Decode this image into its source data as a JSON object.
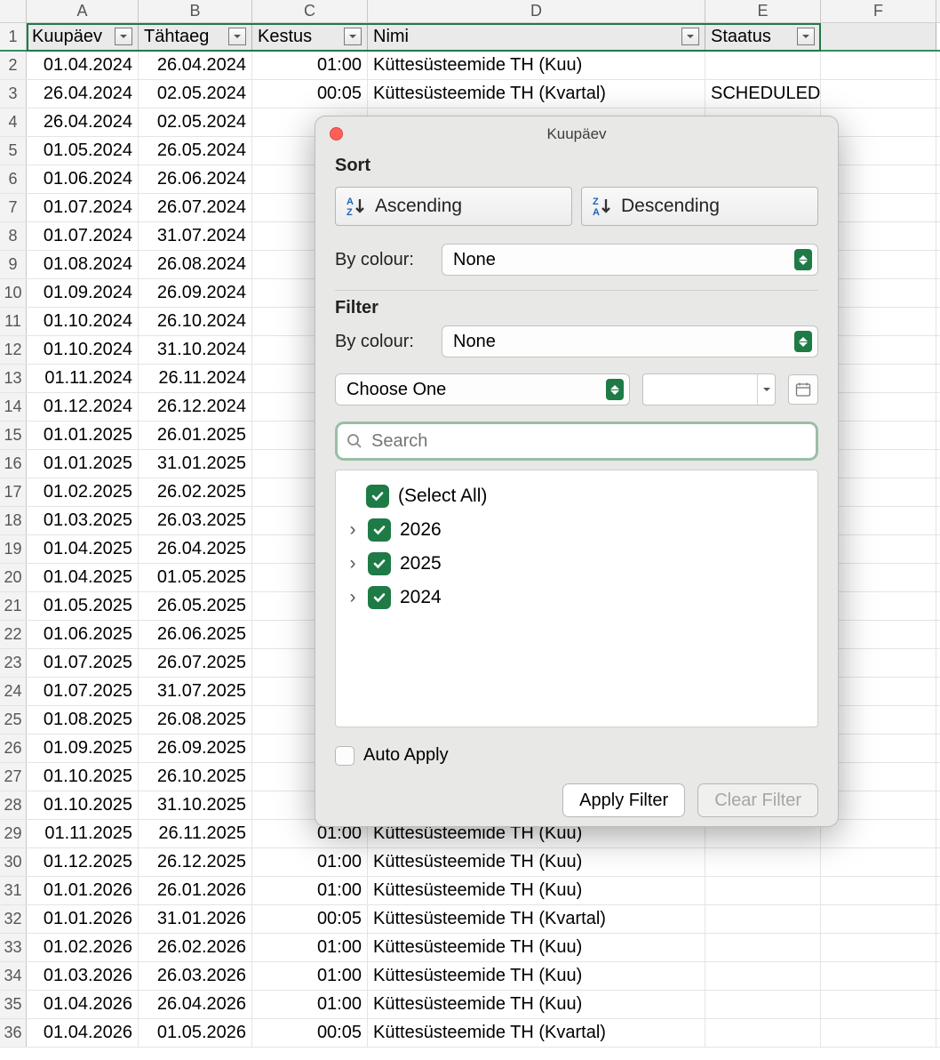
{
  "columns": [
    "A",
    "B",
    "C",
    "D",
    "E",
    "F"
  ],
  "headers": {
    "A": "Kuupäev",
    "B": "Tähtaeg",
    "C": "Kestus",
    "D": "Nimi",
    "E": "Staatus"
  },
  "rows": [
    {
      "n": 2,
      "A": "01.04.2024",
      "B": "26.04.2024",
      "C": "01:00",
      "D": "Küttesüsteemide TH (Kuu)",
      "E": ""
    },
    {
      "n": 3,
      "A": "26.04.2024",
      "B": "02.05.2024",
      "C": "00:05",
      "D": "Küttesüsteemide TH (Kvartal)",
      "E": "SCHEDULED"
    },
    {
      "n": 4,
      "A": "26.04.2024",
      "B": "02.05.2024",
      "C": "",
      "D": "",
      "E": ""
    },
    {
      "n": 5,
      "A": "01.05.2024",
      "B": "26.05.2024",
      "C": "",
      "D": "",
      "E": ""
    },
    {
      "n": 6,
      "A": "01.06.2024",
      "B": "26.06.2024",
      "C": "",
      "D": "",
      "E": ""
    },
    {
      "n": 7,
      "A": "01.07.2024",
      "B": "26.07.2024",
      "C": "",
      "D": "",
      "E": ""
    },
    {
      "n": 8,
      "A": "01.07.2024",
      "B": "31.07.2024",
      "C": "",
      "D": "",
      "E": ""
    },
    {
      "n": 9,
      "A": "01.08.2024",
      "B": "26.08.2024",
      "C": "",
      "D": "",
      "E": ""
    },
    {
      "n": 10,
      "A": "01.09.2024",
      "B": "26.09.2024",
      "C": "",
      "D": "",
      "E": ""
    },
    {
      "n": 11,
      "A": "01.10.2024",
      "B": "26.10.2024",
      "C": "",
      "D": "",
      "E": ""
    },
    {
      "n": 12,
      "A": "01.10.2024",
      "B": "31.10.2024",
      "C": "",
      "D": "",
      "E": ""
    },
    {
      "n": 13,
      "A": "01.11.2024",
      "B": "26.11.2024",
      "C": "",
      "D": "",
      "E": ""
    },
    {
      "n": 14,
      "A": "01.12.2024",
      "B": "26.12.2024",
      "C": "",
      "D": "",
      "E": ""
    },
    {
      "n": 15,
      "A": "01.01.2025",
      "B": "26.01.2025",
      "C": "",
      "D": "",
      "E": ""
    },
    {
      "n": 16,
      "A": "01.01.2025",
      "B": "31.01.2025",
      "C": "",
      "D": "",
      "E": ""
    },
    {
      "n": 17,
      "A": "01.02.2025",
      "B": "26.02.2025",
      "C": "",
      "D": "",
      "E": ""
    },
    {
      "n": 18,
      "A": "01.03.2025",
      "B": "26.03.2025",
      "C": "",
      "D": "",
      "E": ""
    },
    {
      "n": 19,
      "A": "01.04.2025",
      "B": "26.04.2025",
      "C": "",
      "D": "",
      "E": ""
    },
    {
      "n": 20,
      "A": "01.04.2025",
      "B": "01.05.2025",
      "C": "",
      "D": "",
      "E": ""
    },
    {
      "n": 21,
      "A": "01.05.2025",
      "B": "26.05.2025",
      "C": "",
      "D": "",
      "E": ""
    },
    {
      "n": 22,
      "A": "01.06.2025",
      "B": "26.06.2025",
      "C": "",
      "D": "",
      "E": ""
    },
    {
      "n": 23,
      "A": "01.07.2025",
      "B": "26.07.2025",
      "C": "",
      "D": "",
      "E": ""
    },
    {
      "n": 24,
      "A": "01.07.2025",
      "B": "31.07.2025",
      "C": "",
      "D": "",
      "E": ""
    },
    {
      "n": 25,
      "A": "01.08.2025",
      "B": "26.08.2025",
      "C": "",
      "D": "",
      "E": ""
    },
    {
      "n": 26,
      "A": "01.09.2025",
      "B": "26.09.2025",
      "C": "",
      "D": "",
      "E": ""
    },
    {
      "n": 27,
      "A": "01.10.2025",
      "B": "26.10.2025",
      "C": "",
      "D": "",
      "E": ""
    },
    {
      "n": 28,
      "A": "01.10.2025",
      "B": "31.10.2025",
      "C": "",
      "D": "",
      "E": ""
    },
    {
      "n": 29,
      "A": "01.11.2025",
      "B": "26.11.2025",
      "C": "01:00",
      "D": "Küttesüsteemide TH (Kuu)",
      "E": ""
    },
    {
      "n": 30,
      "A": "01.12.2025",
      "B": "26.12.2025",
      "C": "01:00",
      "D": "Küttesüsteemide TH (Kuu)",
      "E": ""
    },
    {
      "n": 31,
      "A": "01.01.2026",
      "B": "26.01.2026",
      "C": "01:00",
      "D": "Küttesüsteemide TH (Kuu)",
      "E": ""
    },
    {
      "n": 32,
      "A": "01.01.2026",
      "B": "31.01.2026",
      "C": "00:05",
      "D": "Küttesüsteemide TH (Kvartal)",
      "E": ""
    },
    {
      "n": 33,
      "A": "01.02.2026",
      "B": "26.02.2026",
      "C": "01:00",
      "D": "Küttesüsteemide TH (Kuu)",
      "E": ""
    },
    {
      "n": 34,
      "A": "01.03.2026",
      "B": "26.03.2026",
      "C": "01:00",
      "D": "Küttesüsteemide TH (Kuu)",
      "E": ""
    },
    {
      "n": 35,
      "A": "01.04.2026",
      "B": "26.04.2026",
      "C": "01:00",
      "D": "Küttesüsteemide TH (Kuu)",
      "E": ""
    },
    {
      "n": 36,
      "A": "01.04.2026",
      "B": "01.05.2026",
      "C": "00:05",
      "D": "Küttesüsteemide TH (Kvartal)",
      "E": ""
    }
  ],
  "dialog": {
    "title": "Kuupäev",
    "sort_label": "Sort",
    "ascending": "Ascending",
    "descending": "Descending",
    "by_colour": "By colour:",
    "none": "None",
    "filter_label": "Filter",
    "choose_one": "Choose One",
    "search_placeholder": "Search",
    "select_all": "(Select All)",
    "years": [
      "2026",
      "2025",
      "2024"
    ],
    "auto_apply": "Auto Apply",
    "apply_filter": "Apply Filter",
    "clear_filter": "Clear Filter"
  }
}
